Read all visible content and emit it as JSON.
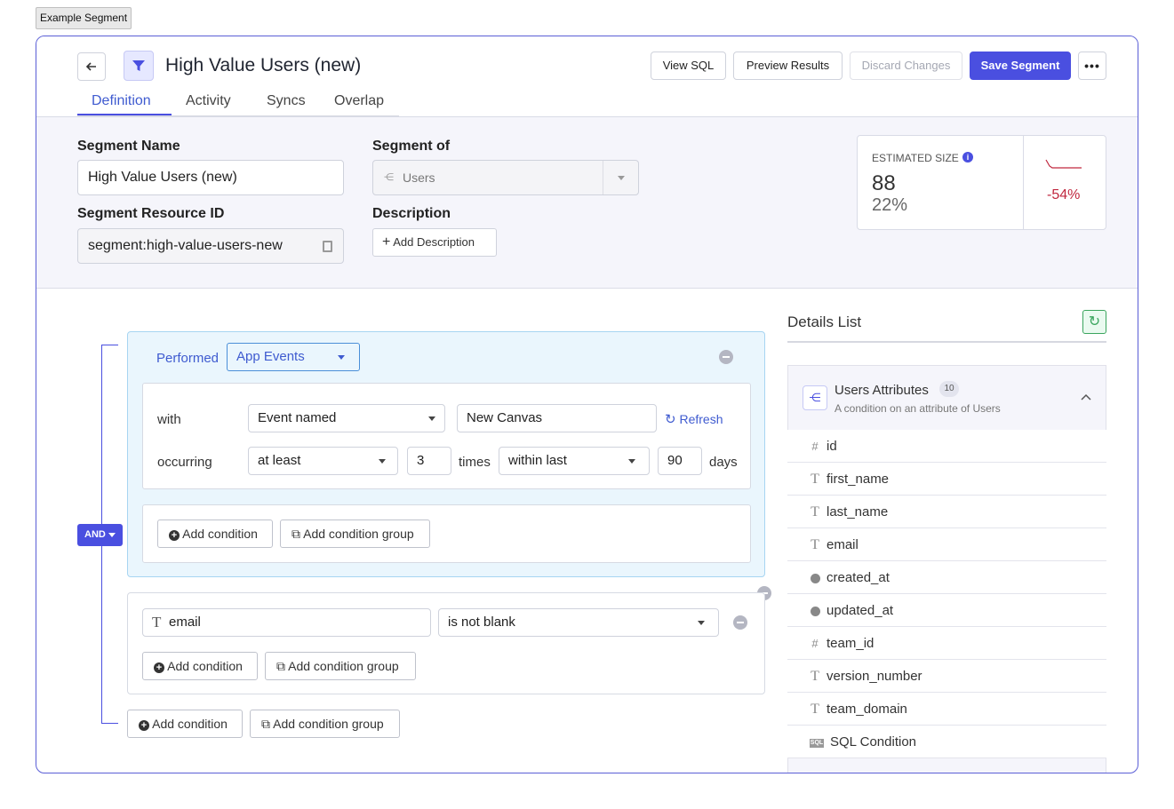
{
  "caption": "Example Segment",
  "header": {
    "title": "High Value Users (new)",
    "view_sql": "View SQL",
    "preview": "Preview Results",
    "discard": "Discard Changes",
    "save": "Save Segment"
  },
  "tabs": [
    "Definition",
    "Activity",
    "Syncs",
    "Overlap"
  ],
  "form": {
    "name_label": "Segment Name",
    "name_value": "High Value Users (new)",
    "of_label": "Segment of",
    "of_value": "Users",
    "resource_label": "Segment Resource ID",
    "resource_value": "segment:high-value-users-new",
    "desc_label": "Description",
    "desc_button": "Add Description"
  },
  "estimate": {
    "label": "ESTIMATED SIZE",
    "count": "88",
    "percent": "22%",
    "change": "-54%",
    "change_color": "#c0283f"
  },
  "builder": {
    "and_label": "AND",
    "group1": {
      "performed": "Performed",
      "source": "App Events",
      "with": "with",
      "event_op": "Event named",
      "event_value": "New Canvas",
      "refresh": "Refresh",
      "occurring": "occurring",
      "freq_op": "at least",
      "freq_value": "3",
      "times": "times",
      "window_op": "within last",
      "window_value": "90",
      "days": "days",
      "add_condition": "Add condition",
      "add_group": "Add condition group"
    },
    "group2": {
      "field": "email",
      "op": "is not blank",
      "add_condition": "Add condition",
      "add_group": "Add condition group"
    },
    "add_condition": "Add condition",
    "add_group": "Add condition group"
  },
  "details": {
    "title": "Details List",
    "section_title": "Users Attributes",
    "section_count": "10",
    "section_sub": "A condition on an attribute of Users",
    "items": [
      {
        "type": "#",
        "name": "id"
      },
      {
        "type": "T",
        "name": "first_name"
      },
      {
        "type": "T",
        "name": "last_name"
      },
      {
        "type": "T",
        "name": "email"
      },
      {
        "type": "clock",
        "name": "created_at"
      },
      {
        "type": "clock",
        "name": "updated_at"
      },
      {
        "type": "#",
        "name": "team_id"
      },
      {
        "type": "T",
        "name": "version_number"
      },
      {
        "type": "T",
        "name": "team_domain"
      },
      {
        "type": "SQL",
        "name": "SQL Condition"
      }
    ]
  },
  "colors": {
    "accent": "#4a4fe0",
    "link": "#3f5bd0",
    "panel_bg": "#eaf6fd"
  }
}
